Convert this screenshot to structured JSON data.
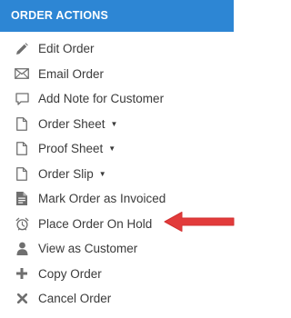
{
  "header": {
    "title": "ORDER ACTIONS"
  },
  "menu": {
    "items": [
      {
        "label": "Edit Order",
        "icon": "pencil-icon",
        "dropdown": false
      },
      {
        "label": "Email Order",
        "icon": "envelope-icon",
        "dropdown": false
      },
      {
        "label": "Add Note for Customer",
        "icon": "comment-icon",
        "dropdown": false
      },
      {
        "label": "Order Sheet",
        "icon": "document-icon",
        "dropdown": true,
        "caret": "▼"
      },
      {
        "label": "Proof Sheet",
        "icon": "document-icon",
        "dropdown": true,
        "caret": "▼"
      },
      {
        "label": "Order Slip",
        "icon": "document-icon",
        "dropdown": true,
        "caret": "▼"
      },
      {
        "label": "Mark Order as Invoiced",
        "icon": "invoice-icon",
        "dropdown": false
      },
      {
        "label": "Place Order On Hold",
        "icon": "alarm-clock-icon",
        "dropdown": false
      },
      {
        "label": "View as Customer",
        "icon": "user-icon",
        "dropdown": false
      },
      {
        "label": "Copy Order",
        "icon": "plus-icon",
        "dropdown": false
      },
      {
        "label": "Cancel Order",
        "icon": "x-icon",
        "dropdown": false
      }
    ]
  },
  "colors": {
    "header_bg": "#2d86d4",
    "arrow": "#e23b3b",
    "icon": "#6f6f6f"
  }
}
